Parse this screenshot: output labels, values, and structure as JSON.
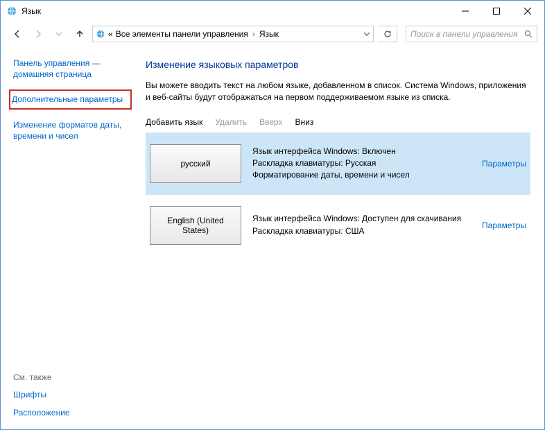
{
  "window": {
    "title": "Язык"
  },
  "breadcrumb": {
    "prefix": "«",
    "items": [
      "Все элементы панели управления",
      "Язык"
    ]
  },
  "search": {
    "placeholder": "Поиск в панели управления"
  },
  "sidebar": {
    "links": [
      {
        "label": "Панель управления — домашняя страница",
        "highlight": false
      },
      {
        "label": "Дополнительные параметры",
        "highlight": true
      },
      {
        "label": "Изменение форматов даты, времени и чисел",
        "highlight": false
      }
    ],
    "see_also_heading": "См. также",
    "see_also": [
      {
        "label": "Шрифты"
      },
      {
        "label": "Расположение"
      }
    ]
  },
  "main": {
    "heading": "Изменение языковых параметров",
    "description": "Вы можете вводить текст на любом языке, добавленном в список. Система Windows, приложения и веб-сайты будут отображаться на первом поддерживаемом языке из списка.",
    "toolbar": {
      "add": "Добавить язык",
      "remove": "Удалить",
      "up": "Вверх",
      "down": "Вниз"
    },
    "languages": [
      {
        "tile": "русский",
        "line1": "Язык интерфейса Windows: Включен",
        "line2": "Раскладка клавиатуры: Русская",
        "line3": "Форматирование даты, времени и чисел",
        "options": "Параметры",
        "selected": true
      },
      {
        "tile": "English (United States)",
        "line1": "Язык интерфейса Windows: Доступен для скачивания",
        "line2": "Раскладка клавиатуры: США",
        "line3": "",
        "options": "Параметры",
        "selected": false
      }
    ]
  }
}
